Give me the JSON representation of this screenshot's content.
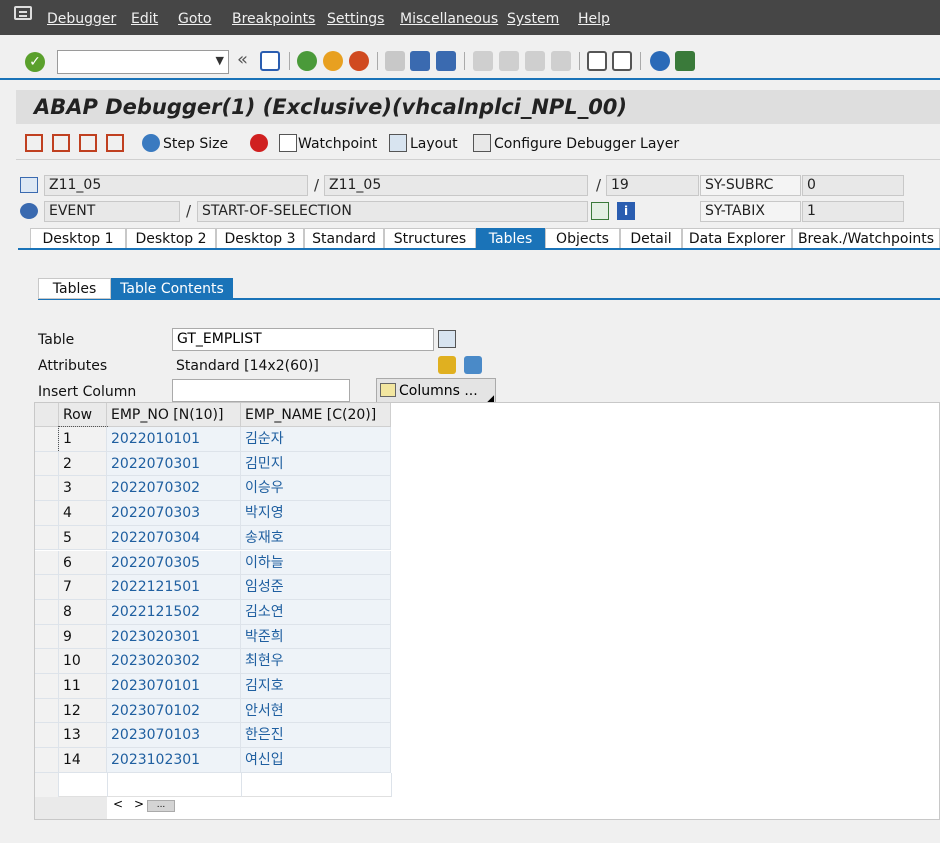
{
  "menubar": {
    "items": [
      "Debugger",
      "Edit",
      "Goto",
      "Breakpoints",
      "Settings",
      "Miscellaneous",
      "System",
      "Help"
    ]
  },
  "toolbar": {
    "back_glyph": "«",
    "command_value": ""
  },
  "title": "ABAP Debugger(1)  (Exclusive)(vhcalnplci_NPL_00)",
  "debug_toolbar": {
    "step_size": "Step Size",
    "watchpoint": "Watchpoint",
    "layout": "Layout",
    "configure": "Configure Debugger Layer"
  },
  "info": {
    "program": "Z11_05",
    "include": "Z11_05",
    "line": "19",
    "subrc_label": "SY-SUBRC",
    "subrc_value": "0",
    "event_type": "EVENT",
    "event_name": "START-OF-SELECTION",
    "tabix_label": "SY-TABIX",
    "tabix_value": "1",
    "slash": "/"
  },
  "main_tabs": [
    "Desktop 1",
    "Desktop 2",
    "Desktop 3",
    "Standard",
    "Structures",
    "Tables",
    "Objects",
    "Detail",
    "Data Explorer",
    "Break./Watchpoints"
  ],
  "sub_tabs": [
    "Tables",
    "Table Contents"
  ],
  "table_form": {
    "table_label": "Table",
    "table_value": "GT_EMPLIST",
    "attributes_label": "Attributes",
    "attributes_value": "Standard [14x2(60)]",
    "insert_column_label": "Insert Column",
    "insert_column_value": "",
    "columns_button": "Columns ..."
  },
  "grid": {
    "headers": [
      "Row",
      "EMP_NO [N(10)]",
      "EMP_NAME [C(20)]"
    ],
    "rows": [
      [
        "1",
        "2022010101",
        "김순자"
      ],
      [
        "2",
        "2022070301",
        "김민지"
      ],
      [
        "3",
        "2022070302",
        "이승우"
      ],
      [
        "4",
        "2022070303",
        "박지영"
      ],
      [
        "5",
        "2022070304",
        "송재호"
      ],
      [
        "6",
        "2022070305",
        "이하늘"
      ],
      [
        "7",
        "2022121501",
        "임성준"
      ],
      [
        "8",
        "2022121502",
        "김소연"
      ],
      [
        "9",
        "2023020301",
        "박준희"
      ],
      [
        "10",
        "2023020302",
        "최현우"
      ],
      [
        "11",
        "2023070101",
        "김지호"
      ],
      [
        "12",
        "2023070102",
        "안서현"
      ],
      [
        "13",
        "2023070103",
        "한은진"
      ],
      [
        "14",
        "2023102301",
        "여신입"
      ]
    ],
    "scroll_left": "<",
    "scroll_right": ">",
    "scroll_more": "..."
  }
}
